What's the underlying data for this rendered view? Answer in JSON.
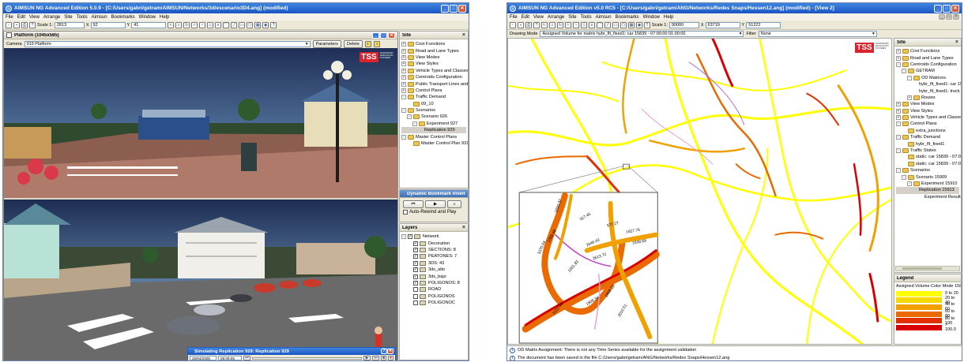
{
  "left_window": {
    "title": "AIMSUN NG Advanced Edition 5.0.9 - [C:/Users/gabri/getram/AIMSUN/Networks/3d/escenario3D4.ang] (modified)",
    "menu": [
      "File",
      "Edit",
      "View",
      "Arrange",
      "Site",
      "Tools",
      "Aimsun",
      "Bookmarks",
      "Window",
      "Help"
    ],
    "toolbar": {
      "scale_label": "Scale 1:",
      "scale_value": "2813",
      "x_label": "X",
      "x_value": "92",
      "y_label": "Y",
      "y_value": "41"
    },
    "view_window": {
      "title": "Platform (1045x585)",
      "camera_label": "Camera",
      "camera_value": "919 Platform",
      "parameters_button": "Parameters",
      "delete_button": "Delete"
    },
    "site_panel": {
      "title": "Site",
      "items": [
        {
          "label": "Cost Functions",
          "level": 0,
          "expander": "+"
        },
        {
          "label": "Road and Lane Types",
          "level": 0,
          "expander": "+"
        },
        {
          "label": "View Modes",
          "level": 0,
          "expander": "+"
        },
        {
          "label": "View Styles",
          "level": 0,
          "expander": "+"
        },
        {
          "label": "Vehicle Types and Classes",
          "level": 0,
          "expander": "+"
        },
        {
          "label": "Centroids Configuration",
          "level": 0,
          "expander": "+"
        },
        {
          "label": "Public Transport Lines and Plans",
          "level": 0,
          "expander": "+"
        },
        {
          "label": "Control Plans",
          "level": 0,
          "expander": "+"
        },
        {
          "label": "Traffic Demand",
          "level": 0,
          "expander": "-"
        },
        {
          "label": "09_10",
          "level": 1,
          "expander": ""
        },
        {
          "label": "Scenarios",
          "level": 0,
          "expander": "-"
        },
        {
          "label": "Scenario 926",
          "level": 1,
          "expander": "-"
        },
        {
          "label": "Experiment 927",
          "level": 2,
          "expander": "-"
        },
        {
          "label": "Replication 929",
          "level": 3,
          "expander": "",
          "selected": true
        },
        {
          "label": "Master Control Plans",
          "level": 0,
          "expander": "-"
        },
        {
          "label": "Master Control Plan 931",
          "level": 1,
          "expander": ""
        }
      ]
    },
    "bookmark_panel": {
      "title": "Dynamic Bookmark Invento...",
      "auto_rewind_label": "Auto-Rewind and Play"
    },
    "layers_panel": {
      "title": "Layers",
      "items": [
        {
          "label": "Network",
          "level": 0
        },
        {
          "label": "Decoration",
          "level": 1
        },
        {
          "label": "SECTIONS: 8",
          "level": 1
        },
        {
          "label": "PEATONES: 7",
          "level": 1
        },
        {
          "label": "3DS: 43",
          "level": 1
        },
        {
          "label": "3ds_alto",
          "level": 1
        },
        {
          "label": "3ds_bajo",
          "level": 1
        },
        {
          "label": "POLIGONOS: 8",
          "level": 1
        },
        {
          "label": "ROAD",
          "level": 1
        },
        {
          "label": "POLIGONOS",
          "level": 1
        },
        {
          "label": "POLIGONOC",
          "level": 1
        }
      ]
    },
    "sim_dialog": {
      "title": "Simulating Replication 929: Replication 929",
      "date": "25/04/2005",
      "time": "09:09:06"
    },
    "tss_logo": "TSS",
    "tss_subtext": "TRANSPORT SIMULATION SYSTEMS"
  },
  "right_window": {
    "title": "AIMSUN NG Advanced Edition v5.0 RC5 - [C:/Users/gabri/getram/ANG/Networks/Redes Snaps/Hessen12.ang] (modified) - [View 2]",
    "menu": [
      "File",
      "Edit",
      "View",
      "Arrange",
      "Site",
      "Tools",
      "Aimsun",
      "Bookmarks",
      "Window",
      "Help"
    ],
    "toolbar": {
      "scale_label": "Scale 1:",
      "scale_value": "90000",
      "x_label": "X",
      "x_value": "63719",
      "y_label": "Y",
      "y_value": "51222"
    },
    "drawing_mode_label": "Drawing Mode",
    "drawing_mode_value": "Assigned Volume for matrix hybr_flt_fixed1: car 15839 - 07:00:00 01:00:00",
    "filter_label": "Filter",
    "filter_value": "None",
    "site_panel": {
      "title": "Site",
      "items": [
        {
          "label": "Cost Functions",
          "level": 0,
          "expander": "+"
        },
        {
          "label": "Road and Lane Types",
          "level": 0,
          "expander": "+"
        },
        {
          "label": "Centroids Configuration",
          "level": 0,
          "expander": "-"
        },
        {
          "label": "GETRAM",
          "level": 1,
          "expander": "-"
        },
        {
          "label": "OD Matrices",
          "level": 2,
          "expander": "-"
        },
        {
          "label": "hybr_flt_fixed1: car 15839",
          "level": 3,
          "expander": ""
        },
        {
          "label": "hybr_flt_fixed1: truck 15...",
          "level": 3,
          "expander": ""
        },
        {
          "label": "Routes",
          "level": 2,
          "expander": "+"
        },
        {
          "label": "View Modes",
          "level": 0,
          "expander": "+"
        },
        {
          "label": "View Styles",
          "level": 0,
          "expander": "+"
        },
        {
          "label": "Vehicle Types and Classes",
          "level": 0,
          "expander": "+"
        },
        {
          "label": "Control Plans",
          "level": 0,
          "expander": "-"
        },
        {
          "label": "extra_junctions",
          "level": 1,
          "expander": ""
        },
        {
          "label": "Traffic Demand",
          "level": 0,
          "expander": "-"
        },
        {
          "label": "hybr_flt_fixed1",
          "level": 1,
          "expander": ""
        },
        {
          "label": "Traffic States",
          "level": 0,
          "expander": "-"
        },
        {
          "label": "static: car 15839 - 07:00:00 01:0...",
          "level": 1,
          "expander": ""
        },
        {
          "label": "static: car 15839 - 07:00:00 01:0...",
          "level": 1,
          "expander": ""
        },
        {
          "label": "Scenarios",
          "level": 0,
          "expander": "-"
        },
        {
          "label": "Scenario 15909",
          "level": 1,
          "expander": "-"
        },
        {
          "label": "Experiment 15910",
          "level": 2,
          "expander": "-"
        },
        {
          "label": "Replication 15913",
          "level": 3,
          "expander": "",
          "selected": true
        },
        {
          "label": "Experiment Result 1...",
          "level": 4,
          "expander": ""
        }
      ]
    },
    "legend": {
      "title": "Legend",
      "subtitle": "Assigned Volume Color Mode 15841",
      "items": [
        {
          "label": "0 to 20",
          "color": "#ffff00"
        },
        {
          "label": "20 to 40",
          "color": "#f5d800"
        },
        {
          "label": "40 to 60",
          "color": "#f0a000"
        },
        {
          "label": "60 to 80",
          "color": "#e86a00"
        },
        {
          "label": "80 to 100",
          "color": "#e03000"
        },
        {
          "label": "> 100.0",
          "color": "#d80000"
        }
      ]
    },
    "messages": [
      "OD Matrix Assignment: There is not any Time Series available for the assignment validation",
      "The document has been saved in the file C:/Users/gabri/getram/ANG/Networks/Redes Snaps/Hessen12.ang"
    ],
    "zoom_labels": [
      "1650.37",
      "317.45",
      "1388.68",
      "1070.04",
      "1001.83",
      "2613.72",
      "2646.43",
      "577.27",
      "1627.76",
      "1638.59",
      "1022.09",
      "1609.34",
      "1669.22",
      "3010.51"
    ],
    "tss_logo": "TSS",
    "tss_subtext": "TRANSPORT SIMULATION SYSTEMS"
  },
  "colors": {
    "title_bar": "#1b55c4",
    "window_bg": "#ece9d8",
    "road_yellow": "#ffff00",
    "road_orange": "#f0a000",
    "road_red": "#d80000"
  }
}
